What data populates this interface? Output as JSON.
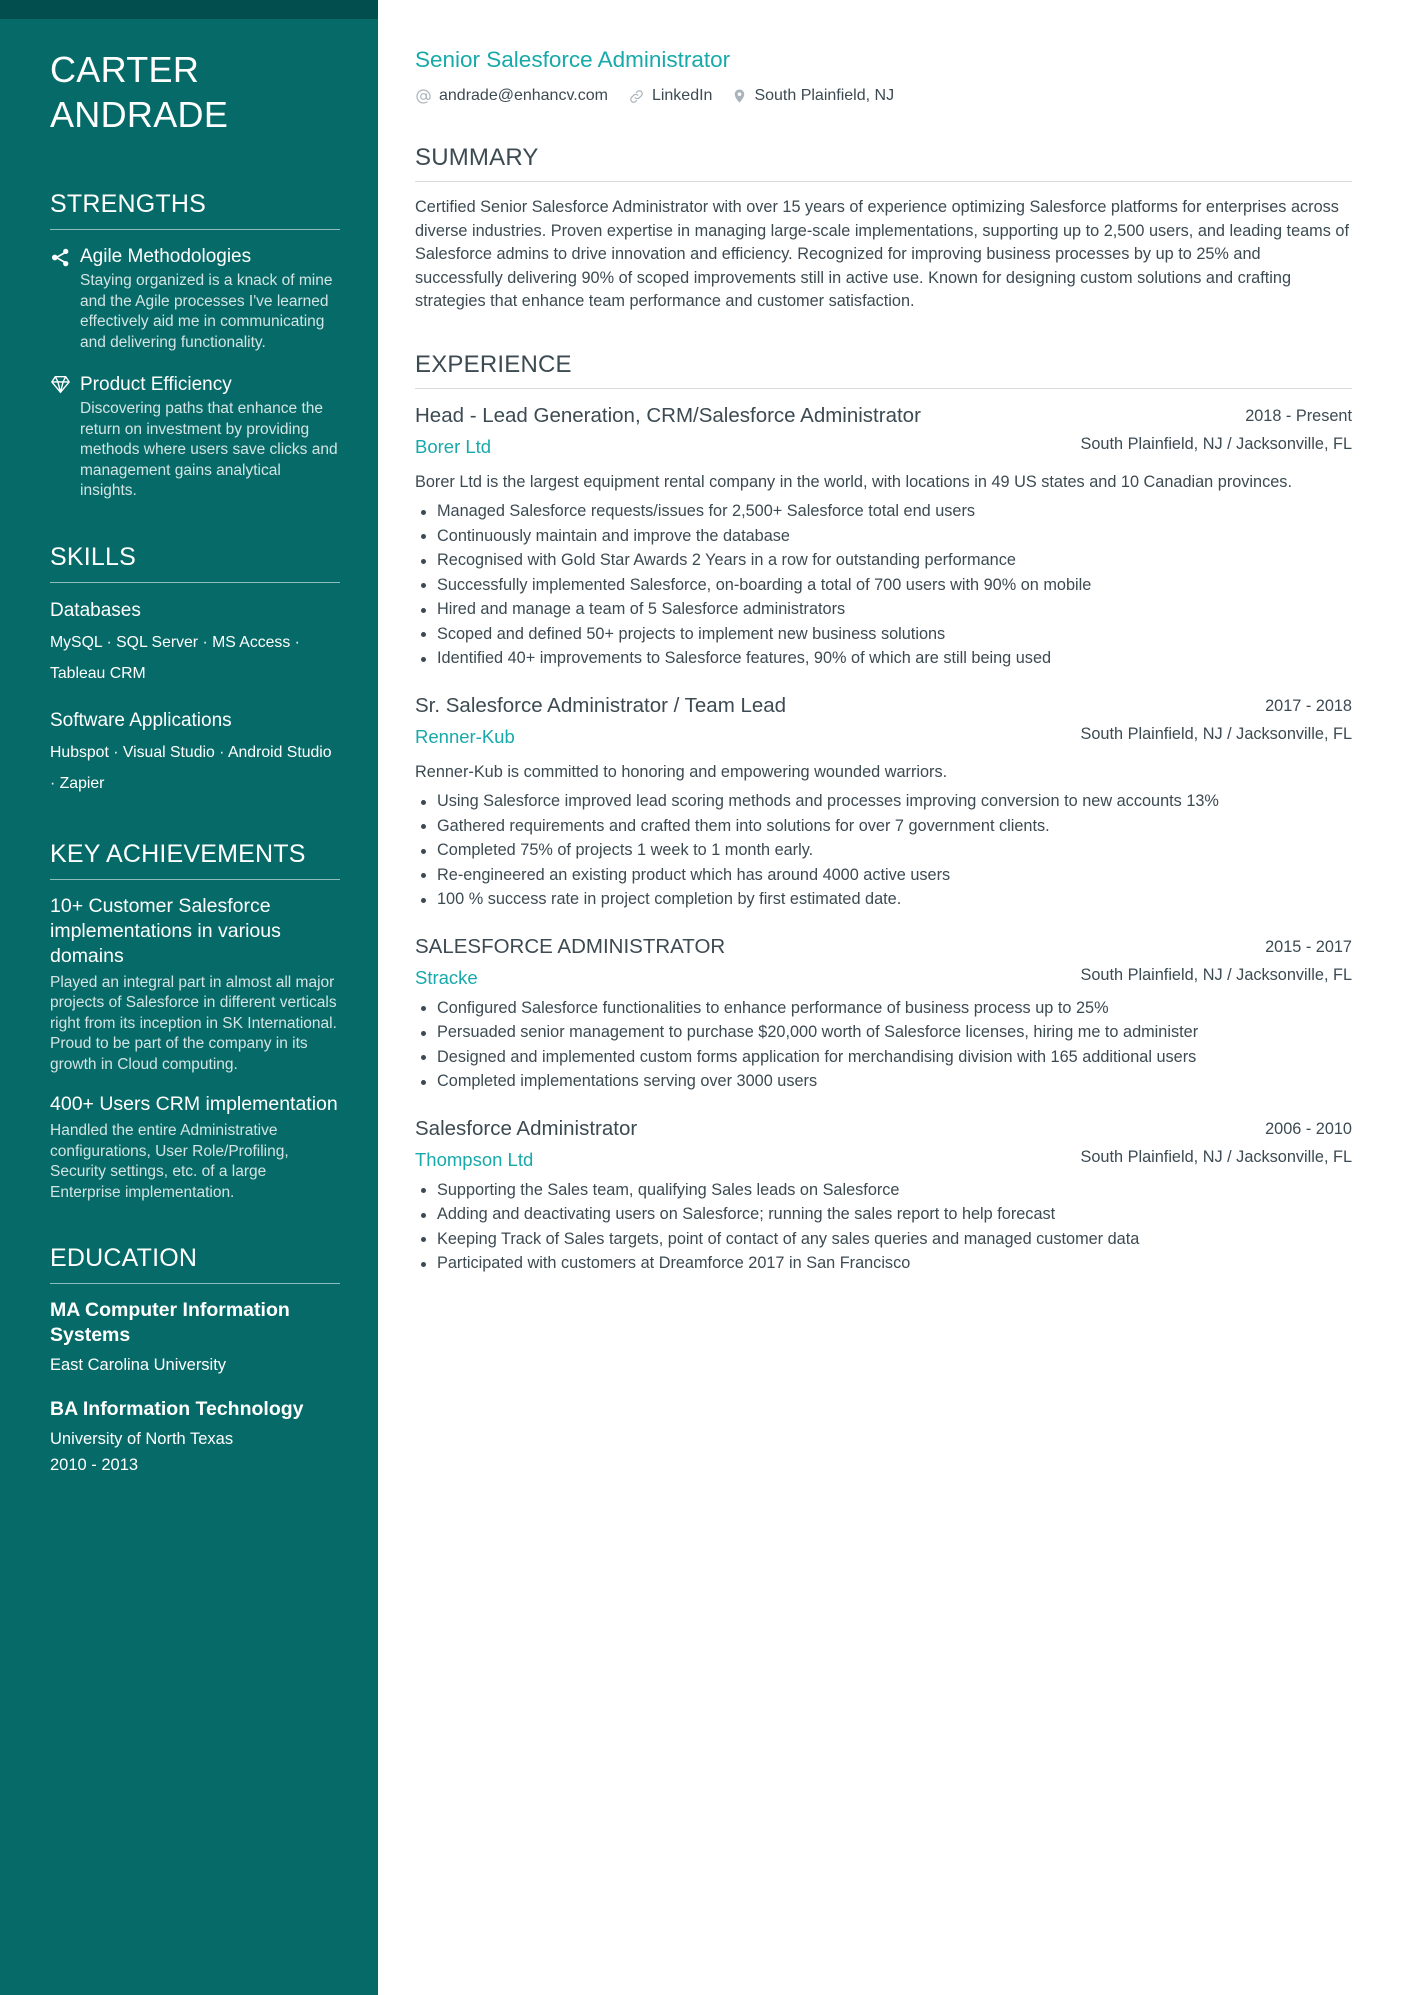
{
  "sidebar": {
    "name_first": "CARTER",
    "name_last": "ANDRADE",
    "strengths": {
      "heading": "STRENGTHS",
      "items": [
        {
          "icon": "share-icon",
          "title": "Agile Methodologies",
          "desc": "Staying organized is a knack of mine and the Agile processes I've learned effectively aid me in communicating and delivering functionality."
        },
        {
          "icon": "diamond-icon",
          "title": "Product Efficiency",
          "desc": "Discovering paths that enhance the return on investment by providing methods where users save clicks and management gains analytical insights."
        }
      ]
    },
    "skills": {
      "heading": "SKILLS",
      "groups": [
        {
          "name": "Databases",
          "items": "MySQL · SQL Server · MS Access · Tableau CRM"
        },
        {
          "name": "Software Applications",
          "items": "Hubspot · Visual Studio · Android Studio · Zapier"
        }
      ]
    },
    "achievements": {
      "heading": "KEY ACHIEVEMENTS",
      "items": [
        {
          "title": "10+ Customer Salesforce implementations in various domains",
          "desc": "Played an integral part in almost all major projects of Salesforce in different verticals right from its inception in SK International. Proud to be part of the company in its growth in Cloud computing."
        },
        {
          "title": "400+ Users CRM implementation",
          "desc": "Handled the entire Administrative configurations, User Role/Profiling, Security settings, etc. of a large Enterprise implementation."
        }
      ]
    },
    "education": {
      "heading": "EDUCATION",
      "items": [
        {
          "degree": "MA Computer Information Systems",
          "school": "East Carolina University",
          "dates": ""
        },
        {
          "degree": "BA Information Technology",
          "school": "University of North Texas",
          "dates": "2010 - 2013"
        }
      ]
    }
  },
  "main": {
    "job_title": "Senior Salesforce Administrator",
    "contacts": [
      {
        "icon": "at-icon",
        "text": "andrade@enhancv.com"
      },
      {
        "icon": "link-icon",
        "text": "LinkedIn"
      },
      {
        "icon": "location-pin-icon",
        "text": "South Plainfield, NJ"
      }
    ],
    "summary": {
      "heading": "SUMMARY",
      "text": "Certified Senior Salesforce Administrator with over 15 years of experience optimizing Salesforce platforms for enterprises across diverse industries. Proven expertise in managing large-scale implementations, supporting up to 2,500 users, and leading teams of Salesforce admins to drive innovation and efficiency. Recognized for improving business processes by up to 25% and successfully delivering 90% of scoped improvements still in active use. Known for designing custom solutions and crafting strategies that enhance team performance and customer satisfaction."
    },
    "experience": {
      "heading": "EXPERIENCE",
      "entries": [
        {
          "role": "Head - Lead Generation, CRM/Salesforce Administrator",
          "dates": "2018 - Present",
          "company": "Borer Ltd",
          "location": "South Plainfield, NJ / Jacksonville, FL",
          "blurb": "Borer Ltd is the largest equipment rental company in the world, with locations in 49 US states and 10 Canadian provinces.",
          "bullets": [
            "Managed Salesforce requests/issues for 2,500+ Salesforce total end users",
            "Continuously maintain and improve the database",
            "Recognised with Gold Star Awards 2 Years in a row for outstanding performance",
            "Successfully implemented Salesforce, on-boarding a total of 700 users with 90% on mobile",
            "Hired and manage a team of 5 Salesforce administrators",
            "Scoped and defined 50+ projects to implement new business solutions",
            "Identified 40+ improvements to Salesforce features, 90% of which are still being used"
          ]
        },
        {
          "role": "Sr. Salesforce Administrator / Team Lead",
          "dates": "2017 - 2018",
          "company": "Renner-Kub",
          "location": "South Plainfield, NJ / Jacksonville, FL",
          "blurb": "Renner-Kub is committed to honoring and empowering wounded warriors.",
          "bullets": [
            "Using Salesforce improved lead scoring methods and processes improving conversion to new accounts 13%",
            "Gathered requirements and crafted them into solutions for over 7 government clients.",
            "Completed 75% of projects 1 week to 1 month early.",
            "Re-engineered an existing product which has around 4000 active users",
            "100 % success rate in project completion by first estimated date."
          ]
        },
        {
          "role": "SALESFORCE ADMINISTRATOR",
          "dates": "2015 - 2017",
          "company": "Stracke",
          "location": "South Plainfield, NJ / Jacksonville, FL",
          "blurb": "",
          "bullets": [
            "Configured Salesforce functionalities to enhance performance of business process up to 25%",
            "Persuaded senior management to purchase $20,000 worth of Salesforce licenses, hiring me to administer",
            "Designed and implemented custom forms application for merchandising division with 165 additional users",
            "Completed implementations serving over 3000 users"
          ]
        },
        {
          "role": "Salesforce Administrator",
          "dates": "2006 - 2010",
          "company": "Thompson Ltd",
          "location": "South Plainfield, NJ / Jacksonville, FL",
          "blurb": "",
          "bullets": [
            "Supporting the Sales team, qualifying Sales leads on Salesforce",
            "Adding and deactivating users on Salesforce; running the sales report to help forecast",
            "Keeping Track of Sales targets, point of contact of any sales queries and managed customer data",
            "Participated with customers at Dreamforce 2017 in San Francisco"
          ]
        }
      ]
    }
  },
  "colors": {
    "sidebar_bg": "#066b68",
    "sidebar_topband": "#024d4d",
    "accent_teal": "#18a9ab",
    "body_text": "#3c4a52"
  }
}
